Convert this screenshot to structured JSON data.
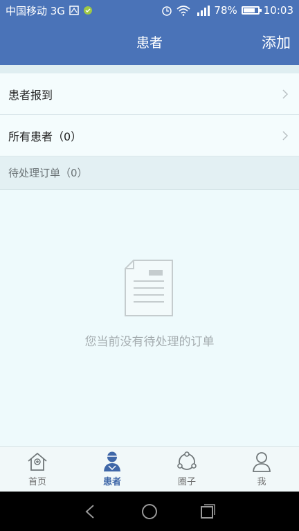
{
  "status_bar": {
    "carrier": "中国移动 3G",
    "battery": "78%",
    "time": "10:03",
    "icons": [
      "sim-icon",
      "sms-icon",
      "alarm-icon",
      "wifi-icon",
      "signal-icon",
      "battery-icon"
    ]
  },
  "navbar": {
    "title": "患者",
    "add_label": "添加"
  },
  "menu": {
    "items": [
      {
        "label": "患者报到"
      },
      {
        "label": "所有患者（0）"
      }
    ]
  },
  "pending_section": {
    "title": "待处理订单（0）",
    "empty_message": "您当前没有待处理的订单",
    "empty_icon": "document-icon"
  },
  "tabbar": {
    "tabs": [
      {
        "label": "首页",
        "icon": "home-icon"
      },
      {
        "label": "患者",
        "icon": "patient-icon",
        "active": true
      },
      {
        "label": "圈子",
        "icon": "circle-icon"
      },
      {
        "label": "我",
        "icon": "user-icon"
      }
    ]
  },
  "system_nav": {
    "icons": [
      "back-icon",
      "home-circle-icon",
      "recents-icon"
    ]
  },
  "colors": {
    "brand": "#4a73b8",
    "active_tab": "#3f67a8",
    "page_bg": "#eef9fb"
  }
}
